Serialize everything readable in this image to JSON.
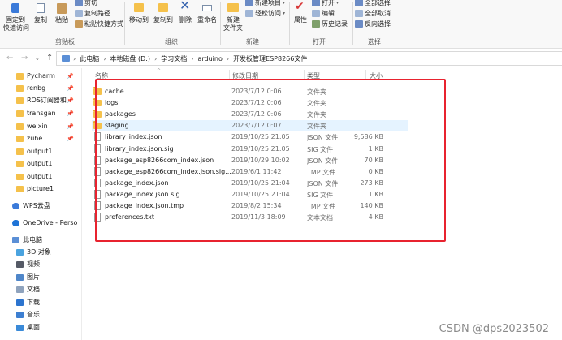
{
  "ribbon": {
    "clipboard": {
      "pin_label": "固定到\n快速访问",
      "copy_label": "复制",
      "paste_label": "粘贴",
      "cut_label": "剪切",
      "copy_path_label": "复制路径",
      "paste_shortcut_label": "粘贴快捷方式",
      "group_label": "剪贴板"
    },
    "organize": {
      "move_to_label": "移动到",
      "copy_to_label": "复制到",
      "delete_label": "删除",
      "rename_label": "重命名",
      "group_label": "组织"
    },
    "new": {
      "new_folder_label": "新建\n文件夹",
      "new_item_label": "新建项目",
      "easy_access_label": "轻松访问",
      "group_label": "新建"
    },
    "open": {
      "properties_label": "属性",
      "open_label": "打开",
      "edit_label": "编辑",
      "history_label": "历史记录",
      "group_label": "打开"
    },
    "select": {
      "select_all_label": "全部选择",
      "select_none_label": "全部取消",
      "invert_label": "反向选择",
      "group_label": "选择"
    }
  },
  "address": {
    "up_glyph": "↑",
    "crumbs": [
      "此电脑",
      "本地磁盘 (D:)",
      "学习文档",
      "arduino",
      "开发板管理ESP8266文件"
    ]
  },
  "nav": {
    "quick_items": [
      "Pycharm",
      "renbg",
      "ROS订阅器和",
      "transgan",
      "weixin",
      "zuhe",
      "output1",
      "output1",
      "output1",
      "picture1"
    ],
    "wps": "WPS云盘",
    "onedrive": "OneDrive - Perso",
    "this_pc": "此电脑",
    "pc_items": [
      "3D 对象",
      "视频",
      "图片",
      "文档",
      "下载",
      "音乐",
      "桌面"
    ]
  },
  "columns": {
    "name": "名称",
    "date": "修改日期",
    "type": "类型",
    "size": "大小"
  },
  "files": [
    {
      "name": "cache",
      "date": "2023/7/12 0:06",
      "type": "文件夹",
      "size": "",
      "kind": "folder"
    },
    {
      "name": "logs",
      "date": "2023/7/12 0:06",
      "type": "文件夹",
      "size": "",
      "kind": "folder"
    },
    {
      "name": "packages",
      "date": "2023/7/12 0:06",
      "type": "文件夹",
      "size": "",
      "kind": "folder"
    },
    {
      "name": "staging",
      "date": "2023/7/12 0:07",
      "type": "文件夹",
      "size": "",
      "kind": "folder"
    },
    {
      "name": "library_index.json",
      "date": "2019/10/25 21:05",
      "type": "JSON 文件",
      "size": "9,586 KB",
      "kind": "file"
    },
    {
      "name": "library_index.json.sig",
      "date": "2019/10/25 21:05",
      "type": "SIG 文件",
      "size": "1 KB",
      "kind": "file"
    },
    {
      "name": "package_esp8266com_index.json",
      "date": "2019/10/29 10:02",
      "type": "JSON 文件",
      "size": "70 KB",
      "kind": "file"
    },
    {
      "name": "package_esp8266com_index.json.sig...",
      "date": "2019/6/1 11:42",
      "type": "TMP 文件",
      "size": "0 KB",
      "kind": "file"
    },
    {
      "name": "package_index.json",
      "date": "2019/10/25 21:04",
      "type": "JSON 文件",
      "size": "273 KB",
      "kind": "file"
    },
    {
      "name": "package_index.json.sig",
      "date": "2019/10/25 21:04",
      "type": "SIG 文件",
      "size": "1 KB",
      "kind": "file"
    },
    {
      "name": "package_index.json.tmp",
      "date": "2019/8/2 15:34",
      "type": "TMP 文件",
      "size": "140 KB",
      "kind": "file"
    },
    {
      "name": "preferences.txt",
      "date": "2019/11/3 18:09",
      "type": "文本文档",
      "size": "4 KB",
      "kind": "file"
    }
  ],
  "selected_row": "staging",
  "watermark": "CSDN @dps2023502",
  "colors": {
    "highlight": "#e5f3ff",
    "red_box": "#e8232f",
    "folder": "#f5c14b"
  }
}
